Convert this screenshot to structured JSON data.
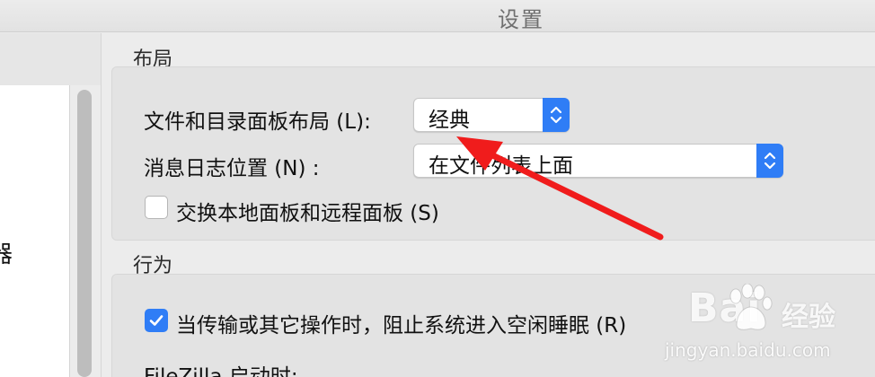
{
  "window": {
    "title": "设置"
  },
  "sidebar": {
    "clipped_text": "器"
  },
  "sections": {
    "layout": {
      "label": "布局",
      "file_dir_layout": {
        "label": "文件和目录面板布局 (L):",
        "value": "经典"
      },
      "message_log_position": {
        "label": "消息日志位置 (N) :",
        "value": "在文件列表上面"
      },
      "swap_panels": {
        "label": "交换本地面板和远程面板 (S)",
        "checked": false
      }
    },
    "behavior": {
      "label": "行为",
      "prevent_sleep": {
        "label": "当传输或其它操作时，阻止系统进入空闲睡眠 (R)",
        "checked": true
      },
      "startup_label": "FileZilla 启动时:"
    }
  },
  "watermark": {
    "brand": "Bai",
    "brand_suffix": "经验",
    "url": "jingyan.baidu.com"
  },
  "colors": {
    "accent": "#2f7df6",
    "annotation": "#f01c1c"
  }
}
